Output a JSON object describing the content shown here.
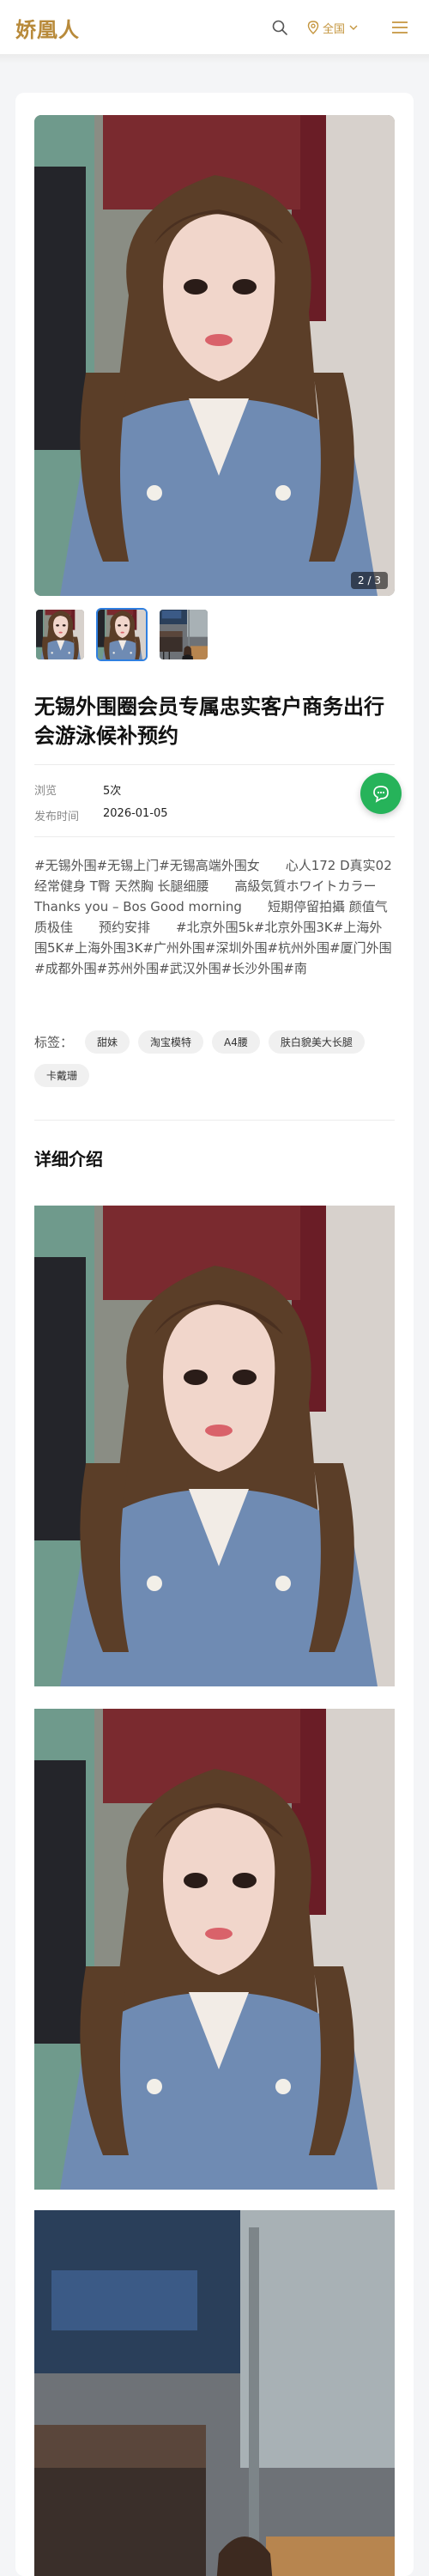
{
  "header": {
    "logo": "娇凰人",
    "city_label": "全国"
  },
  "gallery": {
    "counter": "2 / 3",
    "thumbnails": [
      "portrait-photo-1",
      "portrait-photo-2",
      "bar-photo-3"
    ],
    "active_index": 1
  },
  "post": {
    "title": "无锡外围圈会员专属忠实客户商务出行会游泳候补预约",
    "meta": [
      {
        "key": "浏览",
        "value": "5次"
      },
      {
        "key": "发布时间",
        "value": "2026-01-05"
      }
    ],
    "description": "#无锡外围#无锡上门#无锡高端外围女　　心人172 D真实02　　经常健身 T臀 天然胸 长腿细腰　　高級気質ホワイトカラー　　Thanks you – Bos Good morning　　短期停留拍攝 颜值气质极佳　　预约安排　　#北京外围5k#北京外围3K#上海外围5K#上海外围3K#广州外围#深圳外围#杭州外围#厦门外围#成都外围#苏州外围#武汉外围#长沙外围#南",
    "tags_label": "标签：",
    "tags": [
      "甜妹",
      "淘宝模特",
      "A4腰",
      "肤白貌美大长腿",
      "卡戴珊"
    ]
  },
  "details": {
    "title": "详细介绍",
    "images": [
      "portrait-photo",
      "portrait-photo",
      "bar-photo"
    ]
  },
  "colors": {
    "brand_gold": "#b88a3a",
    "city_gold": "#c4953e",
    "chat_green": "#26b35a",
    "active_thumb": "#2f7fe0"
  },
  "icons": [
    "search-icon",
    "location-pin-icon",
    "chevron-down-icon",
    "menu-icon",
    "chat-icon"
  ]
}
